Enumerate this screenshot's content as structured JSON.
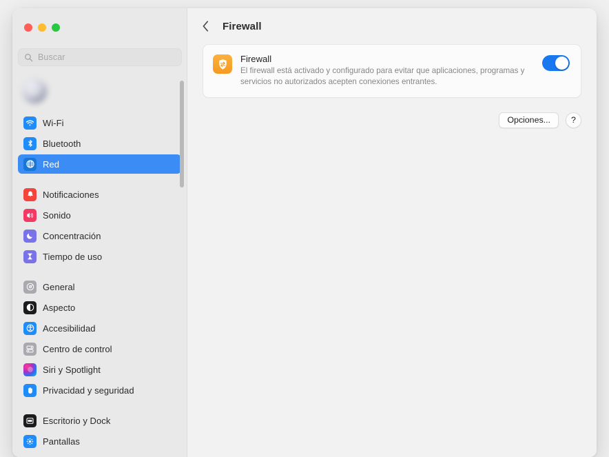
{
  "window": {
    "traffic_lights": [
      {
        "name": "close",
        "color": "#ff5f57"
      },
      {
        "name": "minimize",
        "color": "#febc2e"
      },
      {
        "name": "zoom",
        "color": "#28c840"
      }
    ]
  },
  "sidebar": {
    "search": {
      "placeholder": "Buscar",
      "value": "",
      "icon": "search-icon"
    },
    "account": {
      "name": "",
      "subtitle": "",
      "blurred": true
    },
    "groups": [
      {
        "items": [
          {
            "label": "Wi-Fi",
            "icon": "wifi-icon",
            "color": "#1f8cf9",
            "selected": false
          },
          {
            "label": "Bluetooth",
            "icon": "bluetooth-icon",
            "color": "#1f8cf9",
            "selected": false
          },
          {
            "label": "Red",
            "icon": "network-globe-icon",
            "color": "#1f8cf9",
            "selected": true
          }
        ]
      },
      {
        "items": [
          {
            "label": "Notificaciones",
            "icon": "bell-icon",
            "color": "#f4453c",
            "selected": false
          },
          {
            "label": "Sonido",
            "icon": "speaker-icon",
            "color": "#f33a64",
            "selected": false
          },
          {
            "label": "Concentración",
            "icon": "moon-icon",
            "color": "#7a72e8",
            "selected": false
          },
          {
            "label": "Tiempo de uso",
            "icon": "hourglass-icon",
            "color": "#7a72e8",
            "selected": false
          }
        ]
      },
      {
        "items": [
          {
            "label": "General",
            "icon": "gear-icon",
            "color": "#a9a9af",
            "selected": false
          },
          {
            "label": "Aspecto",
            "icon": "appearance-icon",
            "color": "#1c1c1e",
            "selected": false
          },
          {
            "label": "Accesibilidad",
            "icon": "accessibility-icon",
            "color": "#1f8cf9",
            "selected": false
          },
          {
            "label": "Centro de control",
            "icon": "control-center-icon",
            "color": "#a9a9af",
            "selected": false
          },
          {
            "label": "Siri y Spotlight",
            "icon": "siri-icon",
            "color": "#7b3fe4",
            "selected": false
          },
          {
            "label": "Privacidad y seguridad",
            "icon": "privacy-hand-icon",
            "color": "#1f8cf9",
            "selected": false
          }
        ]
      },
      {
        "items": [
          {
            "label": "Escritorio y Dock",
            "icon": "desktop-dock-icon",
            "color": "#1c1c1e",
            "selected": false
          },
          {
            "label": "Pantallas",
            "icon": "displays-icon",
            "color": "#1f8cf9",
            "selected": false
          }
        ]
      }
    ]
  },
  "content": {
    "back_icon": "chevron-left-icon",
    "title": "Firewall",
    "firewall_card": {
      "icon": "firewall-shield-icon",
      "icon_color": "#f59a22",
      "title": "Firewall",
      "description": "El firewall está activado y configurado para evitar que aplicaciones, programas y servicios no autorizados acepten conexiones entrantes.",
      "toggle": {
        "state": "on",
        "color": "#1878f0"
      }
    },
    "actions": {
      "options_label": "Opciones...",
      "help_label": "?"
    }
  }
}
